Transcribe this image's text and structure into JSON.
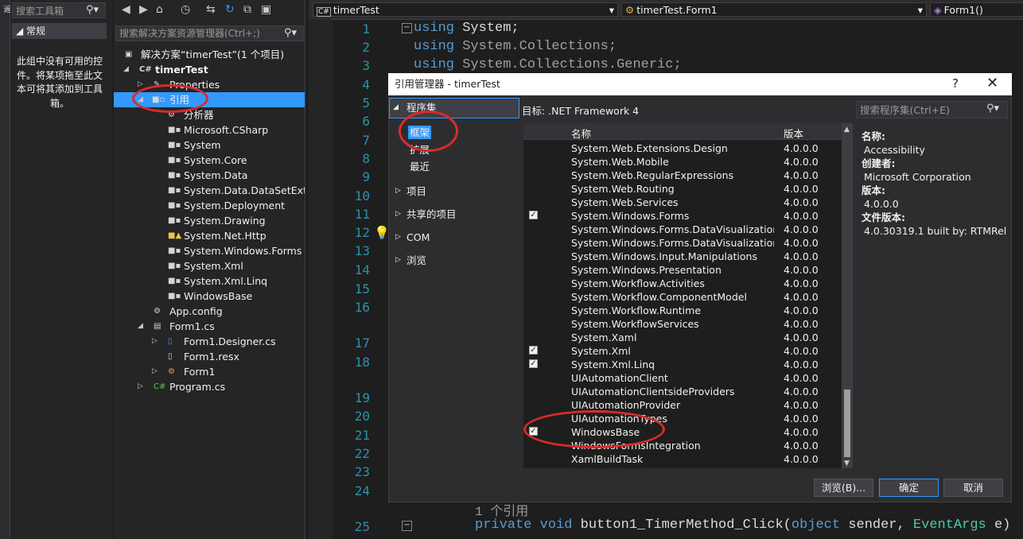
{
  "side_strip_label": "遍",
  "toolbox": {
    "search_placeholder": "搜索工具箱",
    "group_label": "常规",
    "empty_text": "此组中没有可用的控件。将某项拖至此文本可将其添加到工具箱。"
  },
  "solution_explorer": {
    "search_placeholder": "搜索解决方案资源管理器(Ctrl+;)",
    "items": [
      {
        "label": "解决方案“timerTest”(1 个项目)"
      },
      {
        "label": "timerTest"
      },
      {
        "label": "Properties"
      },
      {
        "label": "引用"
      },
      {
        "label": "分析器"
      },
      {
        "label": "Microsoft.CSharp"
      },
      {
        "label": "System"
      },
      {
        "label": "System.Core"
      },
      {
        "label": "System.Data"
      },
      {
        "label": "System.Data.DataSetExtens"
      },
      {
        "label": "System.Deployment"
      },
      {
        "label": "System.Drawing"
      },
      {
        "label": "System.Net.Http"
      },
      {
        "label": "System.Windows.Forms"
      },
      {
        "label": "System.Xml"
      },
      {
        "label": "System.Xml.Linq"
      },
      {
        "label": "WindowsBase"
      },
      {
        "label": "App.config"
      },
      {
        "label": "Form1.cs"
      },
      {
        "label": "Form1.Designer.cs"
      },
      {
        "label": "Form1.resx"
      },
      {
        "label": "Form1"
      },
      {
        "label": "Program.cs"
      }
    ]
  },
  "editor": {
    "file_dropdown": "timerTest",
    "class_dropdown": "timerTest.Form1",
    "member_dropdown": "Form1()",
    "line_numbers": [
      "1",
      "2",
      "3",
      "4",
      "5",
      "6",
      "7",
      "8",
      "9",
      "10",
      "11",
      "12",
      "13",
      "14",
      "15",
      "16",
      "17",
      "18",
      "19",
      "20",
      "21",
      "22",
      "23",
      "24",
      "25"
    ],
    "code": {
      "line1_kw": "using",
      "line1_rest": " System;",
      "line2_kw": "using",
      "line2_rest": " System.Collections;",
      "line3_kw": "using",
      "line3_rest": " System.Collections.Generic;",
      "refs": "1 个引用",
      "line25_a": "private void",
      "line25_b": " button1_TimerMethod_Click(",
      "line25_c": "object",
      "line25_d": " sender, ",
      "line25_e": "EventArgs",
      "line25_f": " e)"
    }
  },
  "dialog": {
    "title": "引用管理器 - timerTest",
    "help_glyph": "?",
    "close_glyph": "✕",
    "nav": {
      "assemblies": "程序集",
      "framework": "框架",
      "extensions": "扩展",
      "recent": "最近",
      "projects": "项目",
      "shared": "共享的项目",
      "com": "COM",
      "browse": "浏览"
    },
    "target": "目标: .NET Framework 4",
    "search_placeholder": "搜索程序集(Ctrl+E)",
    "columns": {
      "name": "名称",
      "version": "版本"
    },
    "rows": [
      {
        "name": "System.Web.Extensions.Design",
        "version": "4.0.0.0",
        "checked": false
      },
      {
        "name": "System.Web.Mobile",
        "version": "4.0.0.0",
        "checked": false
      },
      {
        "name": "System.Web.RegularExpressions",
        "version": "4.0.0.0",
        "checked": false
      },
      {
        "name": "System.Web.Routing",
        "version": "4.0.0.0",
        "checked": false
      },
      {
        "name": "System.Web.Services",
        "version": "4.0.0.0",
        "checked": false
      },
      {
        "name": "System.Windows.Forms",
        "version": "4.0.0.0",
        "checked": true
      },
      {
        "name": "System.Windows.Forms.DataVisualization",
        "version": "4.0.0.0",
        "checked": false
      },
      {
        "name": "System.Windows.Forms.DataVisualization....",
        "version": "4.0.0.0",
        "checked": false
      },
      {
        "name": "System.Windows.Input.Manipulations",
        "version": "4.0.0.0",
        "checked": false
      },
      {
        "name": "System.Windows.Presentation",
        "version": "4.0.0.0",
        "checked": false
      },
      {
        "name": "System.Workflow.Activities",
        "version": "4.0.0.0",
        "checked": false
      },
      {
        "name": "System.Workflow.ComponentModel",
        "version": "4.0.0.0",
        "checked": false
      },
      {
        "name": "System.Workflow.Runtime",
        "version": "4.0.0.0",
        "checked": false
      },
      {
        "name": "System.WorkflowServices",
        "version": "4.0.0.0",
        "checked": false
      },
      {
        "name": "System.Xaml",
        "version": "4.0.0.0",
        "checked": false
      },
      {
        "name": "System.Xml",
        "version": "4.0.0.0",
        "checked": true
      },
      {
        "name": "System.Xml.Linq",
        "version": "4.0.0.0",
        "checked": true
      },
      {
        "name": "UIAutomationClient",
        "version": "4.0.0.0",
        "checked": false
      },
      {
        "name": "UIAutomationClientsideProviders",
        "version": "4.0.0.0",
        "checked": false
      },
      {
        "name": "UIAutomationProvider",
        "version": "4.0.0.0",
        "checked": false
      },
      {
        "name": "UIAutomationTypes",
        "version": "4.0.0.0",
        "checked": false
      },
      {
        "name": "WindowsBase",
        "version": "4.0.0.0",
        "checked": true
      },
      {
        "name": "WindowsFormsIntegration",
        "version": "4.0.0.0",
        "checked": false
      },
      {
        "name": "XamlBuildTask",
        "version": "4.0.0.0",
        "checked": false
      }
    ],
    "details": {
      "name_label": "名称:",
      "name_value": "Accessibility",
      "creator_label": "创建者:",
      "creator_value": "Microsoft Corporation",
      "version_label": "版本:",
      "version_value": "4.0.0.0",
      "file_version_label": "文件版本:",
      "file_version_value": "4.0.30319.1 built by: RTMRel"
    },
    "buttons": {
      "browse": "浏览(B)...",
      "ok": "确定",
      "cancel": "取消"
    }
  },
  "colors": {
    "accent": "#3399ff",
    "annotation": "#d92b2b",
    "keyword": "#569cd6",
    "type": "#4ec9b0"
  }
}
